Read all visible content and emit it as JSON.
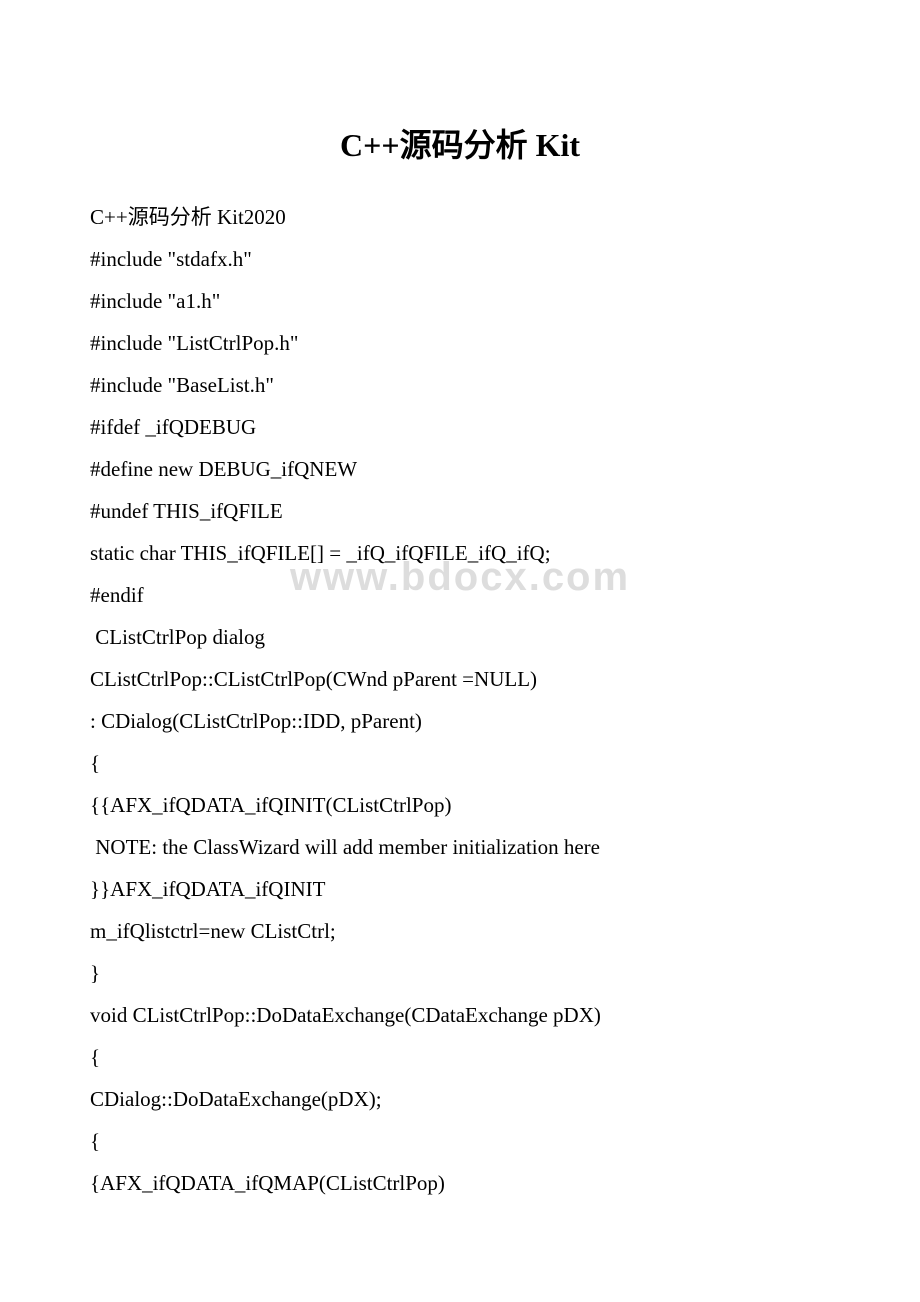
{
  "title": "C++源码分析 Kit",
  "watermark": "www.bdocx.com",
  "lines": [
    "C++源码分析 Kit2020",
    "#include \"stdafx.h\"",
    "#include \"a1.h\"",
    "#include \"ListCtrlPop.h\"",
    "#include \"BaseList.h\"",
    "#ifdef _ifQDEBUG",
    "#define new DEBUG_ifQNEW",
    "#undef THIS_ifQFILE",
    "static char THIS_ifQFILE[] = _ifQ_ifQFILE_ifQ_ifQ;",
    "#endif",
    " CListCtrlPop dialog",
    "CListCtrlPop::CListCtrlPop(CWnd pParent =NULL)",
    ": CDialog(CListCtrlPop::IDD, pParent)",
    "{",
    "{{AFX_ifQDATA_ifQINIT(CListCtrlPop)",
    " NOTE: the ClassWizard will add member initialization here",
    "}}AFX_ifQDATA_ifQINIT",
    "m_ifQlistctrl=new CListCtrl;",
    "}",
    "void CListCtrlPop::DoDataExchange(CDataExchange pDX)",
    "{",
    "CDialog::DoDataExchange(pDX);",
    "{",
    "{AFX_ifQDATA_ifQMAP(CListCtrlPop)"
  ]
}
